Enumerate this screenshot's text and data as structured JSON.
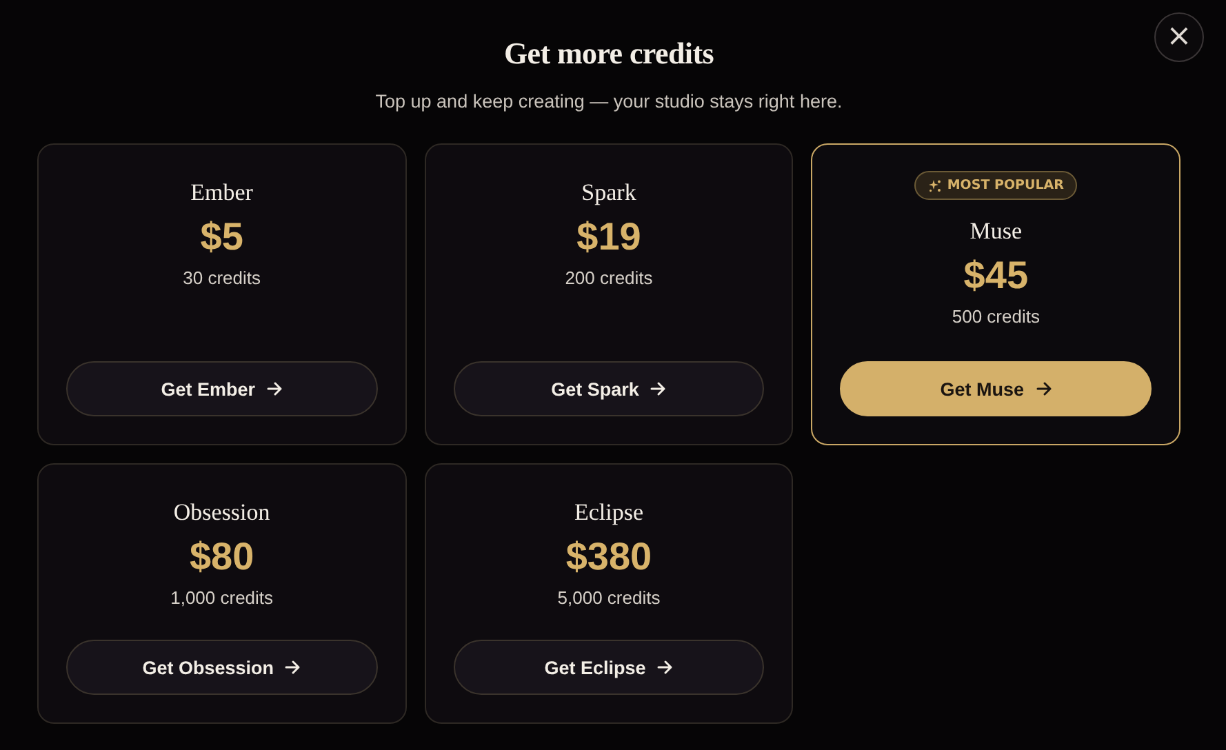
{
  "dialog": {
    "title": "Get more credits",
    "subtitle": "Top up and keep creating — your studio stays right here.",
    "close": "×"
  },
  "plans": [
    {
      "name": "Ember",
      "price": "$5",
      "credits": "30 credits",
      "button": "Get Ember",
      "featured": false
    },
    {
      "name": "Spark",
      "price": "$19",
      "credits": "200 credits",
      "button": "Get Spark",
      "featured": false
    },
    {
      "name": "Muse",
      "price": "$45",
      "credits": "500 credits",
      "button": "Get Muse",
      "featured": true,
      "badge": "MOST POPULAR"
    },
    {
      "name": "Obsession",
      "price": "$80",
      "credits": "1,000 credits",
      "button": "Get Obsession",
      "featured": false
    },
    {
      "name": "Eclipse",
      "price": "$380",
      "credits": "5,000 credits",
      "button": "Get Eclipse",
      "featured": false
    }
  ]
}
